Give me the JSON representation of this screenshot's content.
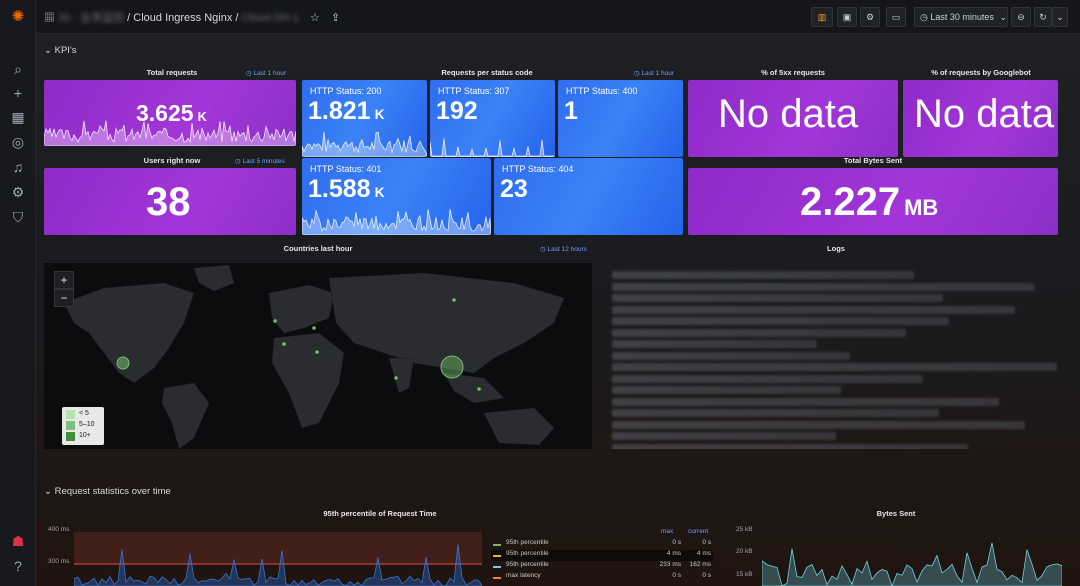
{
  "breadcrumb": {
    "prefix_blurred": "20 · 业务监控",
    "separator": "/",
    "dashboard": "Cloud Ingress Nginx",
    "suffix_blurred": "Cloud-SH-1"
  },
  "toolbar": {
    "time_range": "Last 30 minutes"
  },
  "rows": {
    "kpis": "KPI's",
    "request_stats": "Request statistics over time"
  },
  "panels": {
    "total_requests": {
      "title": "Total requests",
      "time_link": "Last 1 hour",
      "value": "3.625",
      "unit": "K"
    },
    "status_code": {
      "title": "Requests per status code",
      "time_link": "Last 1 hour"
    },
    "pct_5xx": {
      "title": "% of 5xx requests",
      "value": "No data"
    },
    "pct_googlebot": {
      "title": "% of requests by Googlebot",
      "value": "No data"
    },
    "users_now": {
      "title": "Users right now",
      "time_link": "Last 5 minutes",
      "value": "38"
    },
    "total_bytes": {
      "title": "Total Bytes Sent",
      "value": "2.227",
      "unit": "MB"
    },
    "countries": {
      "title": "Countries last hour",
      "time_link": "Last 12 hours"
    },
    "logs": {
      "title": "Logs"
    },
    "p95": {
      "title": "95th percentile of Request Time"
    },
    "bytes_sent": {
      "title": "Bytes Sent"
    }
  },
  "status_tiles": [
    {
      "label": "HTTP Status: 200",
      "value": "1.821",
      "unit": "K"
    },
    {
      "label": "HTTP Status: 307",
      "value": "192",
      "unit": ""
    },
    {
      "label": "HTTP Status: 400",
      "value": "1",
      "unit": ""
    },
    {
      "label": "HTTP Status: 401",
      "value": "1.588",
      "unit": "K"
    },
    {
      "label": "HTTP Status: 404",
      "value": "23",
      "unit": ""
    }
  ],
  "map": {
    "zoom_in": "+",
    "zoom_out": "−",
    "legend": [
      {
        "label": "< 5",
        "color": "#b7e3b0"
      },
      {
        "label": "5–10",
        "color": "#7cc17a"
      },
      {
        "label": "10+",
        "color": "#3f8f3f"
      }
    ]
  },
  "p95_chart": {
    "y_ticks": [
      "400 ms",
      "300 ms"
    ],
    "legend_headers": {
      "max": "max",
      "current": "current"
    },
    "legend_rows": [
      {
        "name": "95th percentile",
        "max": "0 s",
        "current": "0 s",
        "color": "#7eb26d"
      },
      {
        "name": "95th percentile",
        "max": "4 ms",
        "current": "4 ms",
        "color": "#eab839"
      },
      {
        "name": "95th percentile",
        "max": "233 ms",
        "current": "162 ms",
        "color": "#6ed0e0"
      },
      {
        "name": "max latency",
        "max": "0 s",
        "current": "0 s",
        "color": "#ef843c"
      }
    ]
  },
  "bytes_chart": {
    "y_ticks": [
      "25 kB",
      "20 kB",
      "15 kB"
    ]
  },
  "colors": {
    "purple": "#a336d8",
    "blue": "#3b82f6",
    "link": "#6e9fff",
    "map_dot": "#73bf69"
  }
}
